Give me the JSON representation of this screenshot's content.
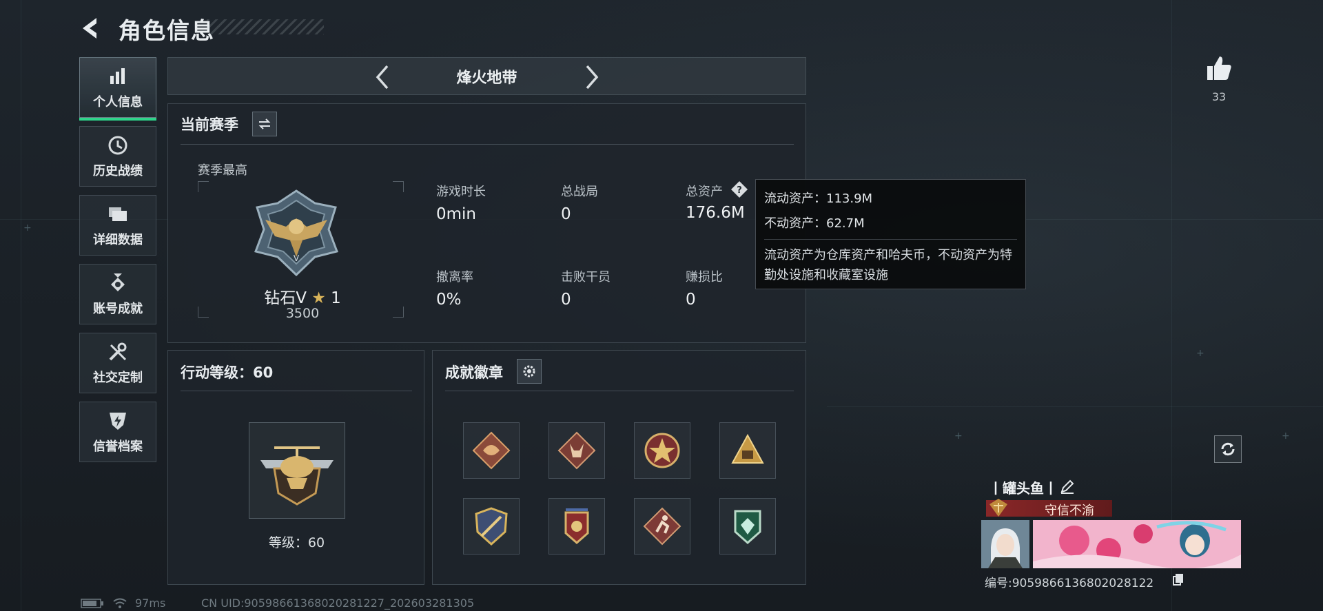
{
  "header": {
    "title": "角色信息"
  },
  "sidebar": {
    "items": [
      {
        "label": "个人信息",
        "icon": "bar-chart-icon",
        "active": true
      },
      {
        "label": "历史战绩",
        "icon": "history-clock-icon",
        "active": false
      },
      {
        "label": "详细数据",
        "icon": "folder-icon",
        "active": false
      },
      {
        "label": "账号成就",
        "icon": "medal-icon",
        "active": false
      },
      {
        "label": "社交定制",
        "icon": "tools-icon",
        "active": false
      },
      {
        "label": "信誉档案",
        "icon": "shield-bolt-icon",
        "active": false
      }
    ]
  },
  "mode": {
    "title": "烽火地带"
  },
  "season": {
    "title": "当前赛季",
    "best_label": "赛季最高",
    "rank_name": "钻石V",
    "rank_stars": "1",
    "rank_score": "3500",
    "stats": [
      {
        "label": "游戏时长",
        "value": "0min"
      },
      {
        "label": "总战局",
        "value": "0"
      },
      {
        "label": "总资产",
        "value": "176.6M"
      },
      {
        "label": "撤离率",
        "value": "0%"
      },
      {
        "label": "击败干员",
        "value": "0"
      },
      {
        "label": "赚损比",
        "value": "0"
      }
    ]
  },
  "tooltip": {
    "liquid": "流动资产：113.9M",
    "fixed": "不动资产：62.7M",
    "desc": "流动资产为仓库资产和哈夫币，不动资产为特勤处设施和收藏室设施"
  },
  "level": {
    "title": "行动等级：60",
    "caption": "等级：60"
  },
  "badges": {
    "title": "成就徽章",
    "items": [
      "dragon-badge",
      "wolf-badge",
      "star-shield-badge",
      "tent-badge",
      "sword-shield-badge",
      "stars-crest-badge",
      "runner-badge",
      "green-gem-badge"
    ]
  },
  "social": {
    "likes": "33"
  },
  "player": {
    "name": "丨罐头鱼丨",
    "title": "守信不渝",
    "id_text": "编号:9059866136802028122"
  },
  "status_bar": {
    "ping": "97ms",
    "uid": "CN UID:9059866136802028122​7_202603281305"
  },
  "colors": {
    "accent_green": "#2ed58a",
    "banner_red": "#962828"
  }
}
